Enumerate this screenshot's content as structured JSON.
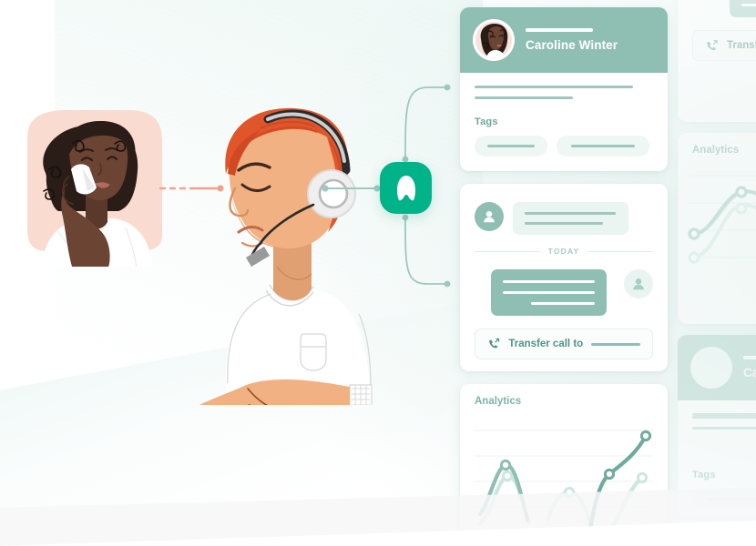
{
  "brand": {
    "name": "Aircall",
    "logo_icon": "aircall-logo-icon",
    "accent": "#00b388",
    "sage": "#8fbfb2",
    "pale": "#eef7f4"
  },
  "illustration": {
    "customer": {
      "name": "customer-on-phone",
      "backdrop_color": "#fadbcf",
      "skin": "#6b4433",
      "hair": "#2a1c17",
      "phone_color": "#ffffff"
    },
    "agent": {
      "name": "support-agent-with-headset",
      "skin": "#f2b183",
      "hair": "#e1552b",
      "shirt": "#ffffff",
      "headset_color": "#e8e8e8"
    },
    "link_customer_to_agent": {
      "name": "customer-link",
      "color": "#f1a28a",
      "style": "dashed-then-solid-with-dot"
    },
    "link_agent_to_brand": {
      "name": "agent-link",
      "color": "#9dc8bf",
      "style": "solid-with-dots"
    }
  },
  "contact_card": {
    "avatar": "caroline-avatar",
    "name": "Caroline Winter",
    "tags_label": "Tags",
    "tags": [
      "",
      ""
    ]
  },
  "conversation_card": {
    "incoming_avatar": "contact-avatar-icon",
    "outgoing_avatar": "agent-avatar-icon",
    "divider_label": "TODAY",
    "transfer": {
      "icon": "phone-forward-icon",
      "label": "Transfer call to",
      "target_value": ""
    }
  },
  "analytics_card": {
    "title": "Analytics",
    "chart_data": {
      "type": "line",
      "title": "Analytics",
      "xlabel": "",
      "ylabel": "",
      "grid": true,
      "gridlines": 5,
      "legend": "none",
      "xlim": [
        0,
        100
      ],
      "ylim": [
        0,
        100
      ],
      "series": [
        {
          "name": "primary",
          "color": "#7fb3a7",
          "x": [
            5,
            18,
            30,
            46,
            52,
            64,
            78,
            94
          ],
          "y": [
            14,
            52,
            72,
            20,
            6,
            46,
            66,
            88
          ],
          "markers": [
            {
              "x": 30,
              "y": 72
            },
            {
              "x": 78,
              "y": 66
            },
            {
              "x": 94,
              "y": 88
            }
          ]
        },
        {
          "name": "secondary",
          "color": "#cde6df",
          "x": [
            7,
            20,
            32,
            44,
            56,
            66,
            76,
            88,
            96
          ],
          "y": [
            10,
            38,
            54,
            14,
            30,
            34,
            4,
            30,
            62
          ],
          "markers": [
            {
              "x": 32,
              "y": 54
            },
            {
              "x": 56,
              "y": 30
            },
            {
              "x": 96,
              "y": 62
            }
          ]
        }
      ]
    }
  },
  "offscreen_cards": {
    "convo_peek": {
      "transfer_label": "Transfe",
      "transfer_icon": "phone-forward-icon"
    },
    "analytics_peek": {
      "title": "Analytics",
      "chart_data": {
        "type": "line",
        "title": "Analytics",
        "grid": true,
        "gridlines": 5,
        "series": [
          {
            "name": "primary",
            "color": "#9cc8bd",
            "x": [
              4,
              20,
              40,
              58,
              78,
              100
            ],
            "y": [
              42,
              48,
              80,
              84,
              50,
              22
            ],
            "markers": [
              {
                "x": 4,
                "y": 42
              },
              {
                "x": 40,
                "y": 80
              }
            ]
          },
          {
            "name": "secondary",
            "color": "#d9ece6",
            "x": [
              4,
              22,
              44,
              62,
              82,
              100
            ],
            "y": [
              14,
              22,
              52,
              56,
              34,
              12
            ],
            "markers": [
              {
                "x": 4,
                "y": 14
              },
              {
                "x": 44,
                "y": 52
              }
            ]
          }
        ]
      }
    },
    "contact_peek": {
      "avatar": "contact-avatar-placeholder",
      "name": "Ca",
      "tags_label": "Tags"
    }
  }
}
